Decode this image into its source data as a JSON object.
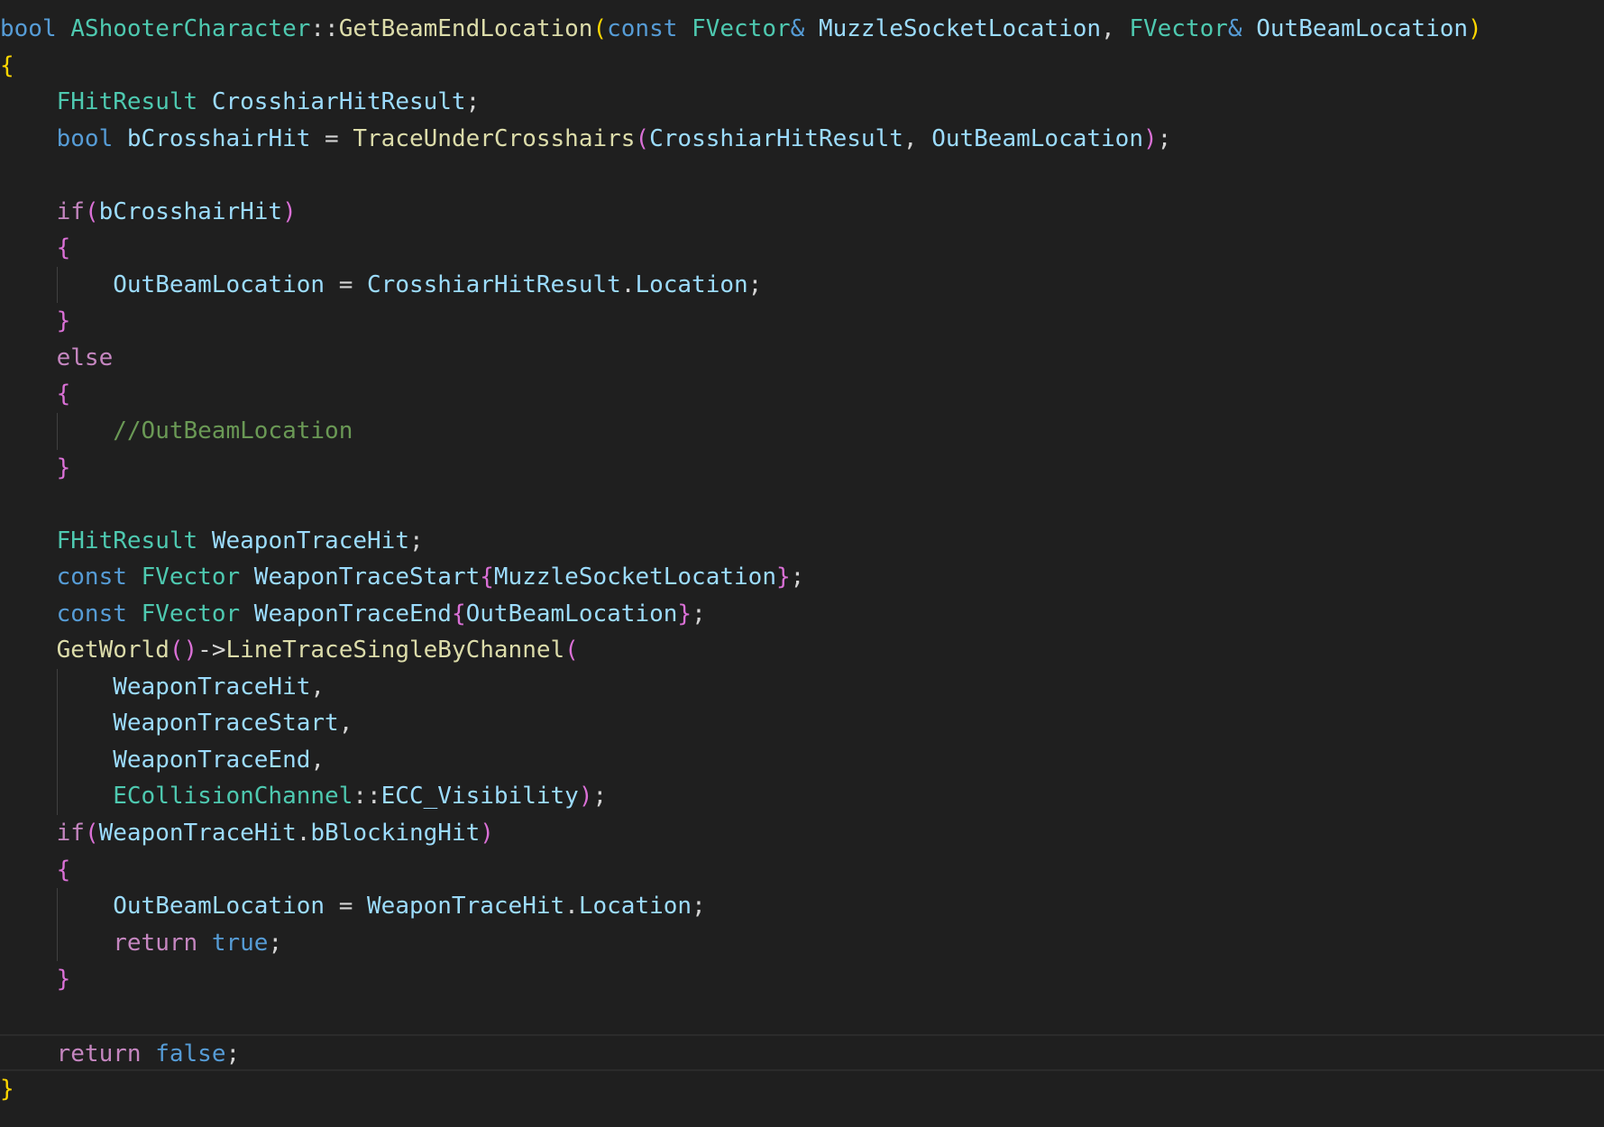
{
  "editor": {
    "theme": {
      "background": "#1f1f1f",
      "keyword": "#569cd6",
      "control": "#c586c0",
      "type": "#4ec9b0",
      "function": "#dcdcaa",
      "variable": "#9cdcfe",
      "comment": "#6a9955",
      "punctuation": "#d4d4d4",
      "bracket_level_1": "#ffd700",
      "bracket_level_2": "#da70d6",
      "bracket_level_3": "#179fff"
    },
    "lines": [
      {
        "tokens": [
          {
            "t": "bool",
            "c": "kw"
          },
          {
            "t": " ",
            "c": "punc"
          },
          {
            "t": "AShooterCharacter",
            "c": "type"
          },
          {
            "t": "::",
            "c": "punc"
          },
          {
            "t": "GetBeamEndLocation",
            "c": "fn"
          },
          {
            "t": "(",
            "c": "br1"
          },
          {
            "t": "const",
            "c": "kw"
          },
          {
            "t": " ",
            "c": "punc"
          },
          {
            "t": "FVector",
            "c": "type"
          },
          {
            "t": "&",
            "c": "kw"
          },
          {
            "t": " ",
            "c": "punc"
          },
          {
            "t": "MuzzleSocketLocation",
            "c": "var"
          },
          {
            "t": ", ",
            "c": "punc"
          },
          {
            "t": "FVector",
            "c": "type"
          },
          {
            "t": "&",
            "c": "kw"
          },
          {
            "t": " ",
            "c": "punc"
          },
          {
            "t": "OutBeamLocation",
            "c": "var"
          },
          {
            "t": ")",
            "c": "br1"
          }
        ]
      },
      {
        "tokens": [
          {
            "t": "{",
            "c": "br1"
          }
        ]
      },
      {
        "indent": 1,
        "tokens": [
          {
            "t": "FHitResult",
            "c": "type"
          },
          {
            "t": " ",
            "c": "punc"
          },
          {
            "t": "CrosshiarHitResult",
            "c": "var"
          },
          {
            "t": ";",
            "c": "punc"
          }
        ]
      },
      {
        "indent": 1,
        "tokens": [
          {
            "t": "bool",
            "c": "kw"
          },
          {
            "t": " ",
            "c": "punc"
          },
          {
            "t": "bCrosshairHit",
            "c": "var"
          },
          {
            "t": " = ",
            "c": "punc"
          },
          {
            "t": "TraceUnderCrosshairs",
            "c": "fn"
          },
          {
            "t": "(",
            "c": "br2"
          },
          {
            "t": "CrosshiarHitResult",
            "c": "var"
          },
          {
            "t": ", ",
            "c": "punc"
          },
          {
            "t": "OutBeamLocation",
            "c": "var"
          },
          {
            "t": ")",
            "c": "br2"
          },
          {
            "t": ";",
            "c": "punc"
          }
        ]
      },
      {
        "tokens": []
      },
      {
        "indent": 1,
        "tokens": [
          {
            "t": "if",
            "c": "ctl"
          },
          {
            "t": "(",
            "c": "br2"
          },
          {
            "t": "bCrosshairHit",
            "c": "var"
          },
          {
            "t": ")",
            "c": "br2"
          }
        ]
      },
      {
        "indent": 1,
        "tokens": [
          {
            "t": "{",
            "c": "br2"
          }
        ]
      },
      {
        "indent": 2,
        "guides": [
          1
        ],
        "tokens": [
          {
            "t": "OutBeamLocation",
            "c": "var"
          },
          {
            "t": " = ",
            "c": "punc"
          },
          {
            "t": "CrosshiarHitResult",
            "c": "var"
          },
          {
            "t": ".",
            "c": "punc"
          },
          {
            "t": "Location",
            "c": "var"
          },
          {
            "t": ";",
            "c": "punc"
          }
        ]
      },
      {
        "indent": 1,
        "tokens": [
          {
            "t": "}",
            "c": "br2"
          }
        ]
      },
      {
        "indent": 1,
        "tokens": [
          {
            "t": "else",
            "c": "ctl"
          }
        ]
      },
      {
        "indent": 1,
        "tokens": [
          {
            "t": "{",
            "c": "br2"
          }
        ]
      },
      {
        "indent": 2,
        "guides": [
          1
        ],
        "tokens": [
          {
            "t": "//OutBeamLocation",
            "c": "cmt"
          }
        ]
      },
      {
        "indent": 1,
        "tokens": [
          {
            "t": "}",
            "c": "br2"
          }
        ]
      },
      {
        "tokens": []
      },
      {
        "indent": 1,
        "tokens": [
          {
            "t": "FHitResult",
            "c": "type"
          },
          {
            "t": " ",
            "c": "punc"
          },
          {
            "t": "WeaponTraceHit",
            "c": "var"
          },
          {
            "t": ";",
            "c": "punc"
          }
        ]
      },
      {
        "indent": 1,
        "tokens": [
          {
            "t": "const",
            "c": "kw"
          },
          {
            "t": " ",
            "c": "punc"
          },
          {
            "t": "FVector",
            "c": "type"
          },
          {
            "t": " ",
            "c": "punc"
          },
          {
            "t": "WeaponTraceStart",
            "c": "var"
          },
          {
            "t": "{",
            "c": "br2"
          },
          {
            "t": "MuzzleSocketLocation",
            "c": "var"
          },
          {
            "t": "}",
            "c": "br2"
          },
          {
            "t": ";",
            "c": "punc"
          }
        ]
      },
      {
        "indent": 1,
        "tokens": [
          {
            "t": "const",
            "c": "kw"
          },
          {
            "t": " ",
            "c": "punc"
          },
          {
            "t": "FVector",
            "c": "type"
          },
          {
            "t": " ",
            "c": "punc"
          },
          {
            "t": "WeaponTraceEnd",
            "c": "var"
          },
          {
            "t": "{",
            "c": "br2"
          },
          {
            "t": "OutBeamLocation",
            "c": "var"
          },
          {
            "t": "}",
            "c": "br2"
          },
          {
            "t": ";",
            "c": "punc"
          }
        ]
      },
      {
        "indent": 1,
        "tokens": [
          {
            "t": "GetWorld",
            "c": "fn"
          },
          {
            "t": "()",
            "c": "br2"
          },
          {
            "t": "->",
            "c": "punc"
          },
          {
            "t": "LineTraceSingleByChannel",
            "c": "fn"
          },
          {
            "t": "(",
            "c": "br2"
          }
        ]
      },
      {
        "indent": 2,
        "guides": [
          1
        ],
        "tokens": [
          {
            "t": "WeaponTraceHit",
            "c": "var"
          },
          {
            "t": ",",
            "c": "punc"
          }
        ]
      },
      {
        "indent": 2,
        "guides": [
          1
        ],
        "tokens": [
          {
            "t": "WeaponTraceStart",
            "c": "var"
          },
          {
            "t": ",",
            "c": "punc"
          }
        ]
      },
      {
        "indent": 2,
        "guides": [
          1
        ],
        "tokens": [
          {
            "t": "WeaponTraceEnd",
            "c": "var"
          },
          {
            "t": ",",
            "c": "punc"
          }
        ]
      },
      {
        "indent": 2,
        "guides": [
          1
        ],
        "tokens": [
          {
            "t": "ECollisionChannel",
            "c": "type"
          },
          {
            "t": "::",
            "c": "punc"
          },
          {
            "t": "ECC_Visibility",
            "c": "var"
          },
          {
            "t": ")",
            "c": "br2"
          },
          {
            "t": ";",
            "c": "punc"
          }
        ]
      },
      {
        "indent": 1,
        "tokens": [
          {
            "t": "if",
            "c": "ctl"
          },
          {
            "t": "(",
            "c": "br2"
          },
          {
            "t": "WeaponTraceHit",
            "c": "var"
          },
          {
            "t": ".",
            "c": "punc"
          },
          {
            "t": "bBlockingHit",
            "c": "var"
          },
          {
            "t": ")",
            "c": "br2"
          }
        ]
      },
      {
        "indent": 1,
        "tokens": [
          {
            "t": "{",
            "c": "br2"
          }
        ]
      },
      {
        "indent": 2,
        "guides": [
          1
        ],
        "tokens": [
          {
            "t": "OutBeamLocation",
            "c": "var"
          },
          {
            "t": " = ",
            "c": "punc"
          },
          {
            "t": "WeaponTraceHit",
            "c": "var"
          },
          {
            "t": ".",
            "c": "punc"
          },
          {
            "t": "Location",
            "c": "var"
          },
          {
            "t": ";",
            "c": "punc"
          }
        ]
      },
      {
        "indent": 2,
        "guides": [
          1
        ],
        "tokens": [
          {
            "t": "return",
            "c": "ctl"
          },
          {
            "t": " ",
            "c": "punc"
          },
          {
            "t": "true",
            "c": "kw"
          },
          {
            "t": ";",
            "c": "punc"
          }
        ]
      },
      {
        "indent": 1,
        "tokens": [
          {
            "t": "}",
            "c": "br2"
          }
        ]
      },
      {
        "tokens": []
      },
      {
        "indent": 1,
        "current": true,
        "tokens": [
          {
            "t": "return",
            "c": "ctl"
          },
          {
            "t": " ",
            "c": "punc"
          },
          {
            "t": "false",
            "c": "kw"
          },
          {
            "t": ";",
            "c": "punc"
          }
        ]
      },
      {
        "tokens": [
          {
            "t": "}",
            "c": "br1"
          }
        ]
      }
    ]
  }
}
